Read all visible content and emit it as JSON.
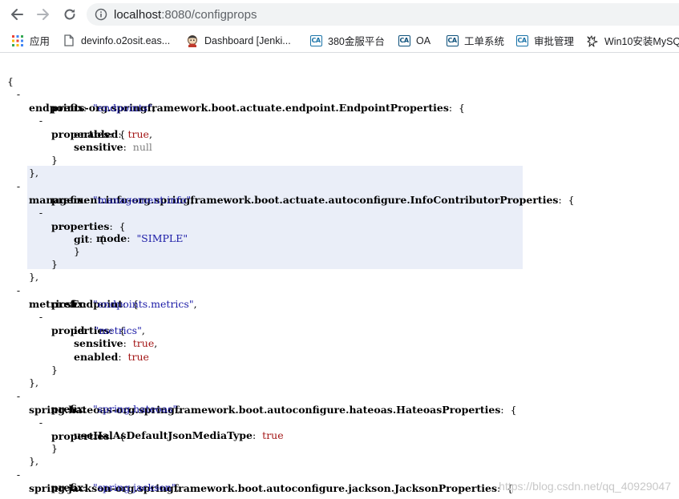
{
  "browser": {
    "url_host": "localhost",
    "url_rest": ":8080/configprops",
    "bookmarks": [
      {
        "label": "应用",
        "icon": "apps-grid-icon"
      },
      {
        "label": "devinfo.o2osit.eas...",
        "icon": "page-icon"
      },
      {
        "label": "Dashboard [Jenki...",
        "icon": "jenkins-icon"
      },
      {
        "label": "380金服平台",
        "icon": "ca-badge-icon"
      },
      {
        "label": "OA",
        "icon": "ca-badge-icon"
      },
      {
        "label": "工单系统",
        "icon": "ca-badge-icon"
      },
      {
        "label": "审批管理",
        "icon": "ca-badge-icon"
      },
      {
        "label": "Win10安装MySQ",
        "icon": "wolf-icon"
      }
    ]
  },
  "json": {
    "open_brace": "{",
    "sections": [
      {
        "key": "endpoints-org.springframework.boot.actuate.endpoint.EndpointProperties",
        "prefix": "\"endpoints\"",
        "properties": {
          "enabled": "true",
          "sensitive": "null"
        }
      },
      {
        "key": "management.info-org.springframework.boot.actuate.autoconfigure.InfoContributorProperties",
        "prefix": "\"management.info\"",
        "git_key": "git",
        "mode": "\"SIMPLE\""
      },
      {
        "key": "metricsEndpoint",
        "prefix": "\"endpoints.metrics\"",
        "properties": {
          "id": "\"metrics\"",
          "sensitive": "true",
          "enabled": "true"
        }
      },
      {
        "key": "spring.hateoas-org.springframework.boot.autoconfigure.hateoas.HateoasProperties",
        "prefix": "\"spring.hateoas\"",
        "properties": {
          "useHalAsDefaultJsonMediaType": "true"
        }
      },
      {
        "key": "spring.jackson-org.springframework.boot.autoconfigure.jackson.JacksonProperties",
        "prefix": "\"spring.jackson\""
      }
    ],
    "labels": {
      "prefix": "prefix",
      "properties": "properties",
      "enabled": "enabled",
      "sensitive": "sensitive",
      "mode": "mode",
      "id": "id",
      "useHal": "useHalAsDefaultJsonMediaType"
    }
  },
  "watermark": "https://blog.csdn.net/qq_40929047"
}
